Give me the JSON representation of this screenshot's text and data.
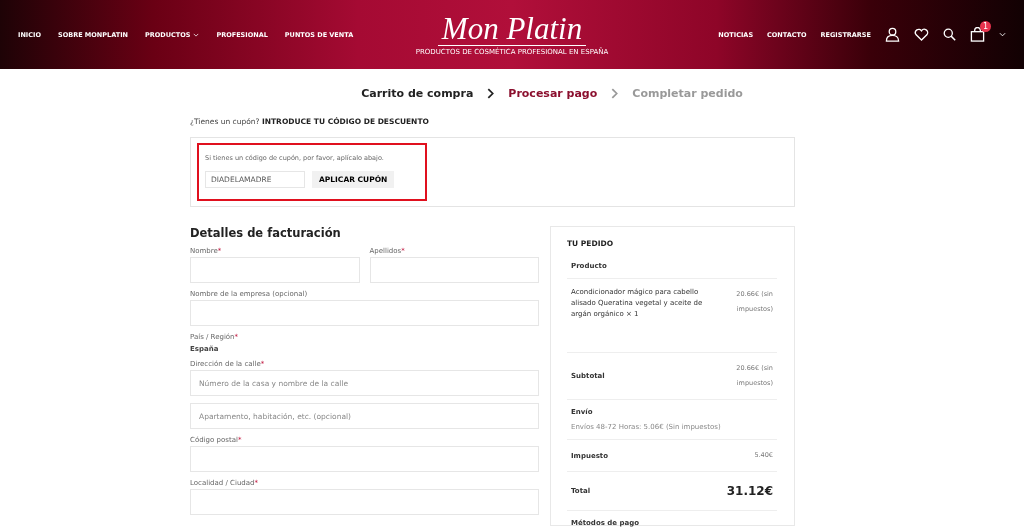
{
  "header": {
    "nav_left": [
      {
        "label": "INICIO",
        "has_caret": false
      },
      {
        "label": "SOBRE MONPLATIN",
        "has_caret": false
      },
      {
        "label": "PRODUCTOS",
        "has_caret": true
      },
      {
        "label": "PROFESIONAL",
        "has_caret": false
      },
      {
        "label": "PUNTOS DE VENTA",
        "has_caret": false
      }
    ],
    "logo": {
      "name": "Mon Platin",
      "tagline": "PRODUCTOS DE COSMÉTICA PROFESIONAL EN ESPAÑA"
    },
    "nav_right": [
      "NOTICIAS",
      "CONTACTO",
      "REGISTRARSE"
    ],
    "cart_badge": "1"
  },
  "steps": [
    {
      "label": "Carrito de compra",
      "selected": false
    },
    {
      "label": "Procesar pago",
      "selected": true
    },
    {
      "label": "Completar pedido",
      "selected": false
    }
  ],
  "coupon": {
    "question": "¿Tienes un cupón?",
    "link": "INTRODUCE TU CÓDIGO DE DESCUENTO",
    "hint": "Si tienes un código de cupón, por favor, aplícalo abajo.",
    "value": "DIADELAMADRE",
    "button": "APLICAR CUPÓN",
    "highlighted": true
  },
  "billing": {
    "title": "Detalles de facturación",
    "rows": [
      [
        {
          "label": "Nombre",
          "mark": "*",
          "kind": "input"
        },
        {
          "label": "Apellidos",
          "mark": "*",
          "kind": "input"
        }
      ],
      [
        {
          "label": "Nombre de la empresa (opcional)",
          "kind": "input"
        }
      ],
      [
        {
          "label": "País / Región",
          "mark": "*",
          "kind": "static",
          "value": "España"
        }
      ],
      [
        {
          "label": "Dirección de la calle",
          "mark": "*",
          "kind": "input",
          "placeholder": "Número de la casa y nombre de la calle"
        }
      ],
      [
        {
          "kind": "input",
          "placeholder": "Apartamento, habitación, etc. (opcional)"
        }
      ],
      [
        {
          "label": "Código postal",
          "mark": "*",
          "kind": "input"
        }
      ],
      [
        {
          "label": "Localidad / Ciudad",
          "mark": "*",
          "kind": "input"
        }
      ]
    ]
  },
  "order": {
    "title": "TU PEDIDO",
    "column_header": "Producto",
    "product": {
      "name": "Acondicionador mágico para cabello alisado Queratina vegetal y aceite de argán orgánico",
      "qty": "× 1",
      "price": "20.66€ (sin impuestos)"
    },
    "subtotal": {
      "label": "Subtotal",
      "value": "20.66€ (sin impuestos)"
    },
    "shipping": {
      "label": "Envío",
      "detail": "Envíos 48-72 Horas: 5.06€ (Sin impuestos)"
    },
    "tax": {
      "label": "Impuesto",
      "value": "5.40€"
    },
    "total": {
      "label": "Total",
      "value": "31.12€"
    },
    "payment_title": "Métodos de pago"
  }
}
